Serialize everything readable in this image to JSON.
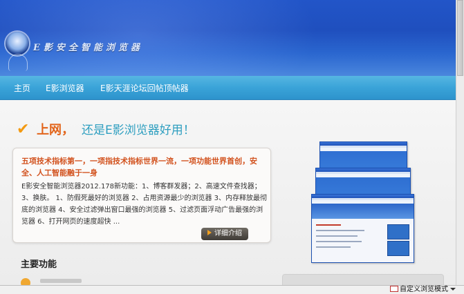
{
  "header": {
    "brand": "E影安全智能浏览器"
  },
  "nav": {
    "items": [
      "主页",
      "E影浏览器",
      "E影天涯论坛回帖顶帖器"
    ]
  },
  "hero": {
    "lead": "上网，",
    "sub": "还是E影浏览器好用！"
  },
  "card": {
    "title": "五项技术指标第一，一项指技术指标世界一流，一项功能世界首创，安全、人工智能融于一身",
    "text": "E影安全智能浏览器2012.178新功能：1、博客群发器；2、高速文件查找器；3、换肤。 1、防假死最好的浏览器 2、占用资源最少的浏览器 3、内存释放最彻底的浏览器 4、安全过滤弹出窗口最强的浏览器 5、过滤页面浮动广告最强的浏览器 6、打开网页的速度超快 ...",
    "more_label": "详细介绍"
  },
  "features": {
    "title": "主要功能"
  },
  "statusbar": {
    "mode_label": "自定义浏览模式"
  },
  "colors": {
    "accent_orange": "#e2641a",
    "accent_blue": "#2f9fc0",
    "nav_blue": "#3aa3d8",
    "header_blue": "#1f4fbe"
  },
  "icons": {
    "logo": "globe-person-logo",
    "check": "checkmark-icon",
    "more": "play-triangle-icon"
  }
}
